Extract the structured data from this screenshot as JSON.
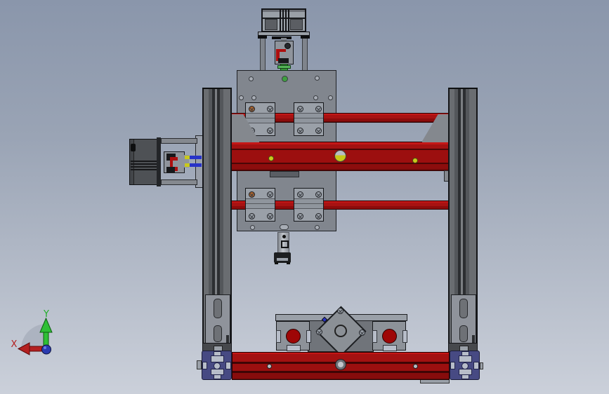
{
  "scene": {
    "type": "cad-3d-viewport",
    "view": "front-orthographic",
    "model_parts": [
      "z-axis-stepper-motor",
      "z-axis-coupling",
      "z-axis-lead-screw",
      "z-carriage-plate",
      "linear-bearing-blocks",
      "upper-guide-rail",
      "gantry-extrusion",
      "lower-guide-rail",
      "left-column-extrusion",
      "right-column-extrusion",
      "corner-gussets",
      "x-axis-stepper-motor",
      "x-axis-coupling",
      "motor-mount-plate",
      "column-foot-plates",
      "base-t-slot-profile-ends",
      "base-extrusion",
      "shaft-support-blocks",
      "rotated-motor-mount-diamond",
      "anti-backlash-nut"
    ]
  },
  "axis_triad": {
    "x_label": "X",
    "y_label": "Y"
  },
  "colors": {
    "bg_top": "#8a96ab",
    "bg_bottom": "#cbd0da",
    "red_main": "#9c0f0f",
    "red_hi": "#c41616",
    "red_low": "#650808",
    "plate": "#81868e",
    "plate_hole": "#a8adb5",
    "block": "#9aa0a8",
    "column_face": "#606368",
    "column_dark": "#2f3134",
    "column_light": "#7b7e82",
    "blue_profile": "#474a83",
    "slot_light": "#b7bdc9",
    "motor_dark": "#4e5155",
    "motor_light": "#9aa0a7",
    "coupling": "#8f949c",
    "green_screw": "#3f9f3f",
    "green_light": "#55b759",
    "yellow": "#c9c91c",
    "orange_screw": "#a8622c",
    "back_plate": "#70747a",
    "diamond": "#8b9096",
    "bearing_red": "#9e0606",
    "gusset": "#84888e",
    "foot_plate": "#8f939b",
    "slot_dark": "#6e7176",
    "shaft_blue": "#2833c8",
    "edge_dark": "#17181b",
    "axis_green": "#1fae27",
    "axis_red": "#b42020",
    "axis_blue": "#2a3bb0"
  }
}
